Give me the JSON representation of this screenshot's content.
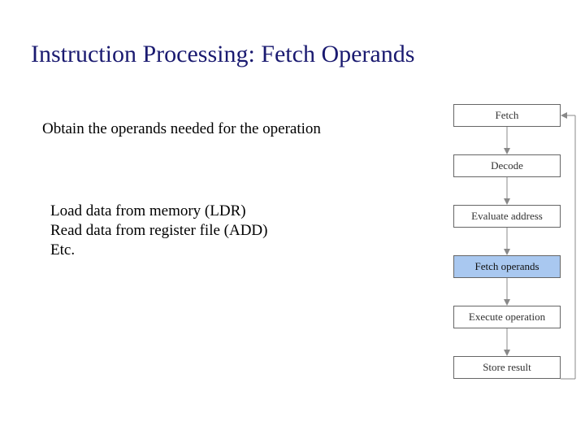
{
  "title": "Instruction Processing: Fetch Operands",
  "subtitle": "Obtain the operands needed for the operation",
  "body": {
    "line1": "Load data from memory (LDR)",
    "line2": "Read data from register file (ADD)",
    "line3": "Etc."
  },
  "flow": {
    "steps": [
      {
        "label": "Fetch",
        "highlight": false
      },
      {
        "label": "Decode",
        "highlight": false
      },
      {
        "label": "Evaluate address",
        "highlight": false
      },
      {
        "label": "Fetch operands",
        "highlight": true
      },
      {
        "label": "Execute operation",
        "highlight": false
      },
      {
        "label": "Store result",
        "highlight": false
      }
    ]
  },
  "colors": {
    "title": "#1a1a70",
    "highlight_bg": "#a9c8f0",
    "arrow": "#888888"
  }
}
